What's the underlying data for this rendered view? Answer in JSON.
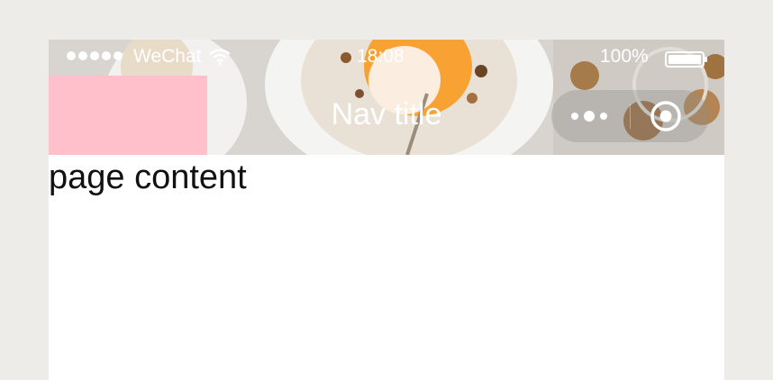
{
  "status_bar": {
    "carrier": "WeChat",
    "time": "18:08",
    "battery": "100%"
  },
  "nav": {
    "title": "Nav title"
  },
  "page": {
    "content": "page content"
  },
  "colors": {
    "background": "#edece9",
    "page": "#ffffff",
    "pink_block": "#ffc0cb",
    "nav_text": "#ffffff"
  },
  "icons": [
    "wifi-icon",
    "battery-icon",
    "more-icon",
    "close-icon",
    "signal-icon"
  ]
}
